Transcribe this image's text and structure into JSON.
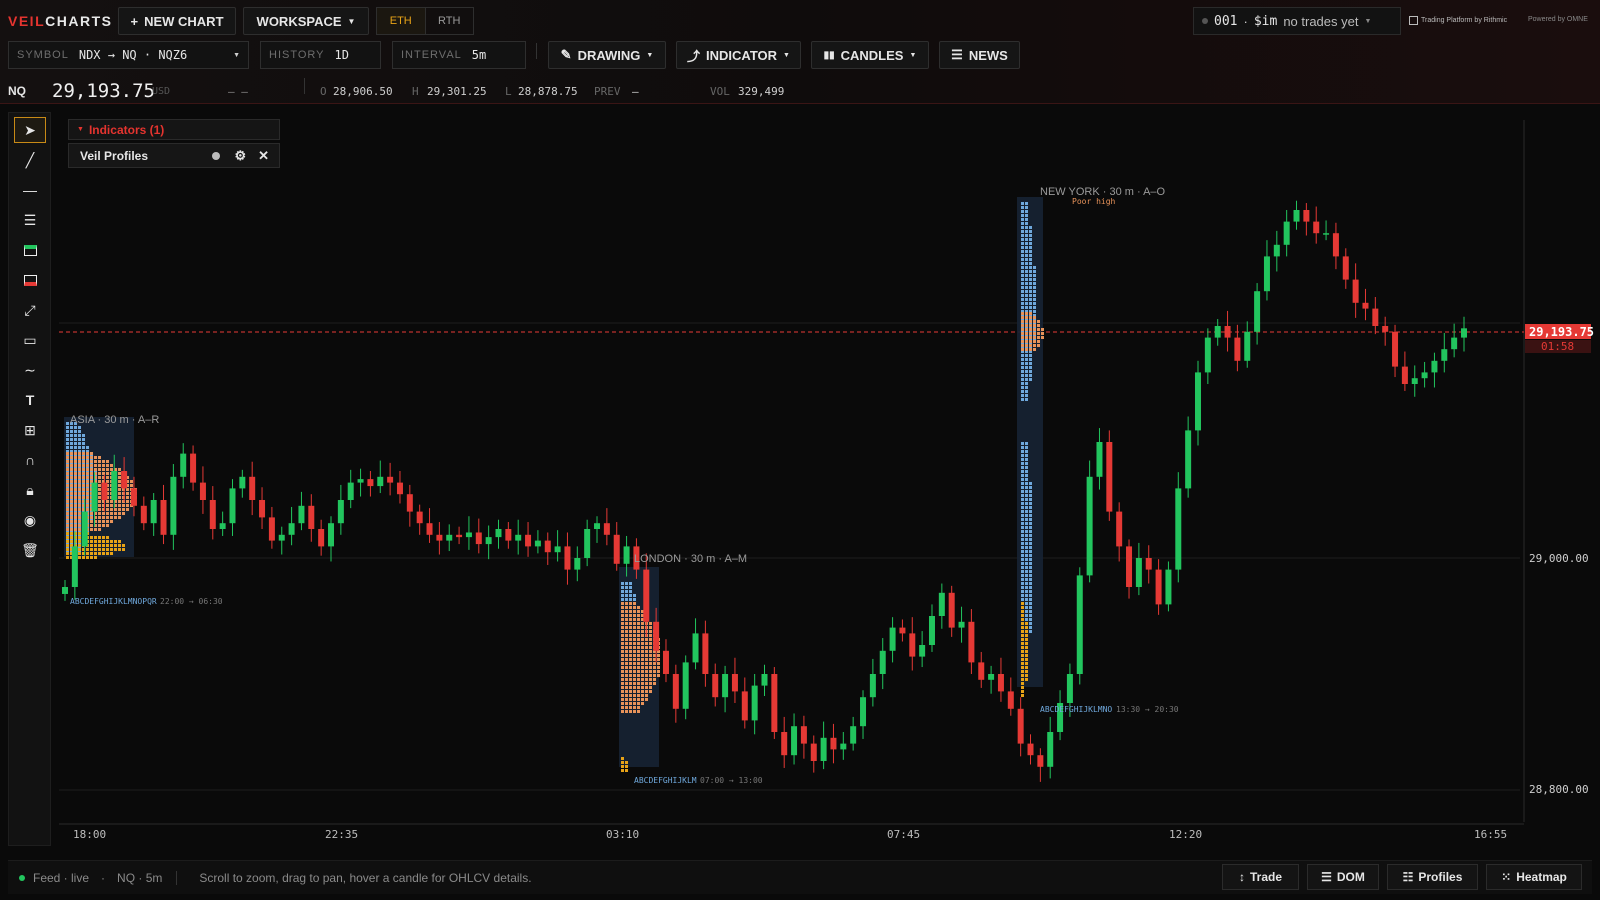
{
  "brand": {
    "red": "VEIL",
    "white": "CHARTS"
  },
  "toolbar": {
    "new_chart": "NEW CHART",
    "workspace": "WORKSPACE",
    "session_eth": "ETH",
    "session_rth": "RTH",
    "drawing": "DRAWING",
    "indicator": "INDICATOR",
    "candles": "CANDLES",
    "news": "NEWS"
  },
  "account": {
    "id": "001",
    "sep": "·",
    "mode": "$im",
    "status": "no trades yet"
  },
  "partners": {
    "rithmic": "Trading Platform by Rithmic",
    "omne": "Powered by OMNE"
  },
  "symbol_bar": {
    "symbol_label": "SYMBOL",
    "symbol_value": "NDX → NQ · NQZ6",
    "history_label": "HISTORY",
    "history_value": "1D",
    "interval_label": "INTERVAL",
    "interval_value": "5m"
  },
  "quote": {
    "ticker": "NQ",
    "last": "29,193.75",
    "currency": "USD",
    "change": "– –",
    "o_label": "O",
    "o": "28,906.50",
    "h_label": "H",
    "h": "29,301.25",
    "l_label": "L",
    "l": "28,878.75",
    "prev_label": "PREV",
    "prev": "–",
    "vol_label": "VOL",
    "vol": "329,499"
  },
  "indicators": {
    "header": "Indicators (1)",
    "item": "Veil Profiles"
  },
  "sessions": {
    "asia": {
      "label": "ASIA · 30 m · A–R",
      "letters": "ABCDEFGHIJKLMNOPQR",
      "time": "22:00 → 06:30"
    },
    "london": {
      "label": "LONDON · 30 m · A–M",
      "letters": "ABCDEFGHIJKLM",
      "time": "07:00 → 13:00"
    },
    "newyork": {
      "label": "NEW YORK · 30 m · A–O",
      "letters": "ABCDEFGHIJKLMNO",
      "time": "13:30 → 20:30",
      "note": "Poor high"
    }
  },
  "price_axis": {
    "tag": "29,193.75",
    "countdown": "01:58",
    "ticks": [
      "29,000.00",
      "28,800.00"
    ]
  },
  "time_axis": [
    "18:00",
    "22:35",
    "03:10",
    "07:45",
    "12:20",
    "16:55"
  ],
  "status": {
    "feed": "Feed · live",
    "sep": "·",
    "symbol": "NQ · 5m",
    "hint": "Scroll to zoom, drag to pan, hover a candle for OHLCV details."
  },
  "bottom_buttons": {
    "trade": "Trade",
    "dom": "DOM",
    "profiles": "Profiles",
    "heatmap": "Heatmap"
  },
  "colors": {
    "up": "#22c55e",
    "down": "#e53935",
    "accent": "#e5342f",
    "amber": "#e8a317",
    "blue": "#6fa8dc",
    "orange": "#e8935a"
  },
  "chart_data": {
    "type": "candlestick",
    "instrument": "NQ",
    "interval": "5m",
    "y_ticks": [
      29000,
      28800
    ],
    "ylim": [
      28760,
      29380
    ],
    "last_price": 29193.75,
    "x_ticks": [
      "18:00",
      "22:35",
      "03:10",
      "07:45",
      "12:20",
      "16:55"
    ],
    "series": [
      {
        "close": [
          28975,
          29010,
          29040,
          29065,
          29050,
          29075,
          29060,
          29045,
          29030,
          29050,
          29020,
          29070,
          29090,
          29065,
          29050,
          29025,
          29030,
          29060,
          29070,
          29050,
          29035,
          29015,
          29020,
          29030,
          29045,
          29025,
          29010,
          29030,
          29050,
          29065,
          29068,
          29062,
          29070,
          29065,
          29055,
          29040,
          29030,
          29020,
          29015,
          29020,
          29018,
          29022,
          29012,
          29018,
          29025,
          29015,
          29020,
          29010,
          29015,
          29005,
          29010,
          28990,
          29000,
          29025,
          29030,
          29020,
          28995,
          29010,
          28990,
          28945,
          28920,
          28900,
          28870,
          28910,
          28935,
          28900,
          28880,
          28900,
          28885,
          28860,
          28890,
          28900,
          28850,
          28830,
          28855,
          28840,
          28825,
          28845,
          28835,
          28840,
          28855,
          28880,
          28900,
          28920,
          28940,
          28935,
          28915,
          28925,
          28950,
          28970,
          28940,
          28945,
          28910,
          28895,
          28900,
          28885,
          28870,
          28840,
          28830,
          28820,
          28850,
          28875,
          28900,
          28985,
          29070,
          29100,
          29040,
          29010,
          28975,
          29000,
          28990,
          28960,
          28990,
          29060,
          29110,
          29160,
          29190,
          29200,
          29190,
          29170,
          29195,
          29230,
          29260,
          29270,
          29290,
          29300,
          29290,
          29280,
          29280,
          29260,
          29240,
          29220,
          29215,
          29200,
          29195,
          29165,
          29150,
          29155,
          29160,
          29170,
          29180,
          29190,
          29198
        ]
      }
    ]
  }
}
